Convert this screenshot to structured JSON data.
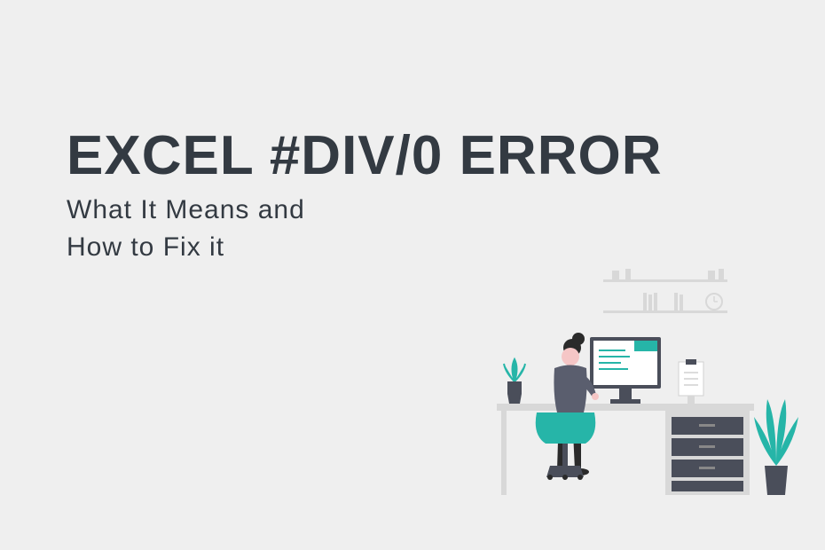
{
  "title": "EXCEL #DIV/0 ERROR",
  "subtitle_line1": "What It Means and",
  "subtitle_line2": "How to Fix it",
  "colors": {
    "background": "#efefef",
    "text": "#333a42",
    "accent_teal": "#26b5a8",
    "accent_pink": "#f5c6c6",
    "accent_dark": "#4a4e5a"
  }
}
